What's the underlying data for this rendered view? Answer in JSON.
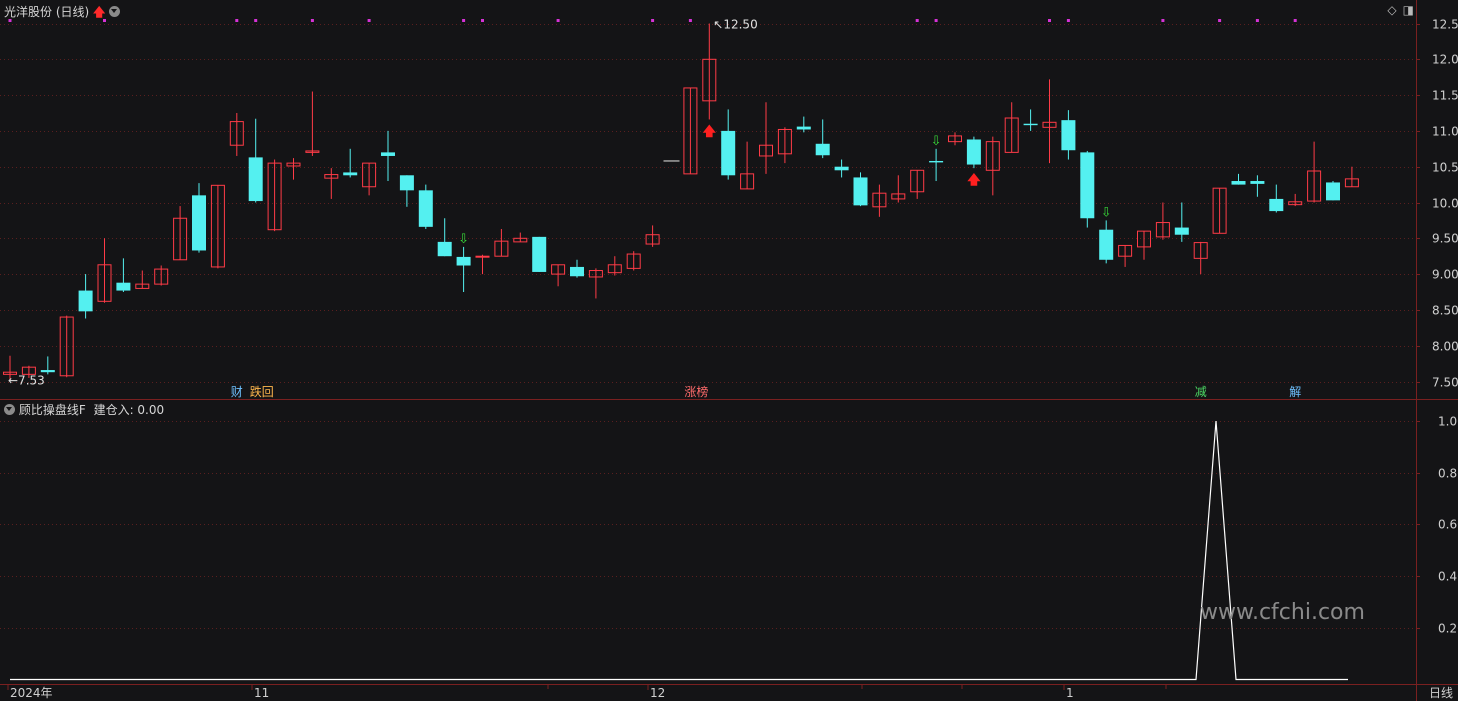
{
  "header": {
    "stock_title": "光洋股份 (日线)",
    "indicator_title": "顾比操盘线F",
    "indicator_value": "建仓入: 0.00"
  },
  "colors": {
    "bg": "#141416",
    "up": "#ff3b47",
    "down": "#54f0f0",
    "grid": "#5a1f1f",
    "signal_dot": "#d632d6"
  },
  "icons": [
    "up-arrow-icon",
    "chevron-down-icon",
    "diamond-icon",
    "panel-toggle-icon"
  ],
  "chart_data": [
    {
      "type": "candlestick",
      "yticks": [
        "12.50",
        "12.00",
        "11.50",
        "11.00",
        "10.50",
        "10.00",
        "9.50",
        "9.00",
        "8.50",
        "8.00",
        "7.50"
      ],
      "ylim": [
        7.4,
        12.65
      ],
      "high_label": "12.50",
      "low_label": "7.53",
      "x_labels": [
        "2024年",
        "11",
        "12",
        "1"
      ],
      "period_label": "日线",
      "candles": [
        [
          7.6,
          7.63,
          7.53,
          7.86
        ],
        [
          7.6,
          7.7,
          7.55,
          7.72
        ],
        [
          7.66,
          7.63,
          7.6,
          7.85
        ],
        [
          7.58,
          8.4,
          7.56,
          8.42
        ],
        [
          8.77,
          8.48,
          8.38,
          9.0
        ],
        [
          8.62,
          9.13,
          8.6,
          9.5
        ],
        [
          8.88,
          8.77,
          8.75,
          9.22
        ],
        [
          8.8,
          8.86,
          8.8,
          9.05
        ],
        [
          8.86,
          9.07,
          8.84,
          9.12
        ],
        [
          9.2,
          9.78,
          9.2,
          9.95
        ],
        [
          10.1,
          9.33,
          9.3,
          10.27
        ],
        [
          9.1,
          10.24,
          9.08,
          10.24
        ],
        [
          10.8,
          11.13,
          10.65,
          11.25
        ],
        [
          10.63,
          10.02,
          10.0,
          11.17
        ],
        [
          9.62,
          10.55,
          9.6,
          10.6
        ],
        [
          10.51,
          10.55,
          10.32,
          10.62
        ],
        [
          10.7,
          10.72,
          10.65,
          11.55
        ],
        [
          10.34,
          10.39,
          10.05,
          10.48
        ],
        [
          10.42,
          10.38,
          10.35,
          10.75
        ],
        [
          10.22,
          10.55,
          10.1,
          10.55
        ],
        [
          10.7,
          10.65,
          10.3,
          11.0
        ],
        [
          10.38,
          10.17,
          9.94,
          10.38
        ],
        [
          10.17,
          9.66,
          9.63,
          10.25
        ],
        [
          9.45,
          9.25,
          9.25,
          9.78
        ],
        [
          9.24,
          9.12,
          8.75,
          9.38
        ],
        [
          9.24,
          9.25,
          9.0,
          9.27
        ],
        [
          9.25,
          9.46,
          9.25,
          9.63
        ],
        [
          9.45,
          9.5,
          9.45,
          9.58
        ],
        [
          9.52,
          9.03,
          9.03,
          9.52
        ],
        [
          9.0,
          9.13,
          8.83,
          9.13
        ],
        [
          9.1,
          8.97,
          8.95,
          9.2
        ],
        [
          8.96,
          9.05,
          8.66,
          9.08
        ],
        [
          9.02,
          9.13,
          8.98,
          9.25
        ],
        [
          9.08,
          9.28,
          9.05,
          9.32
        ],
        [
          9.42,
          9.55,
          9.38,
          9.68
        ],
        [
          10.58,
          10.58,
          10.58,
          10.58
        ],
        [
          10.4,
          11.6,
          10.4,
          11.6
        ],
        [
          11.42,
          12.0,
          11.16,
          12.5
        ],
        [
          11.0,
          10.38,
          10.32,
          11.3
        ],
        [
          10.19,
          10.4,
          10.19,
          10.85
        ],
        [
          10.65,
          10.8,
          10.4,
          11.4
        ],
        [
          10.68,
          11.02,
          10.55,
          11.05
        ],
        [
          11.06,
          11.02,
          10.98,
          11.2
        ],
        [
          10.82,
          10.66,
          10.62,
          11.16
        ],
        [
          10.5,
          10.45,
          10.35,
          10.6
        ],
        [
          10.35,
          9.96,
          9.95,
          10.42
        ],
        [
          9.94,
          10.13,
          9.8,
          10.25
        ],
        [
          10.05,
          10.12,
          10.0,
          10.38
        ],
        [
          10.15,
          10.45,
          10.05,
          10.45
        ],
        [
          10.58,
          10.56,
          10.3,
          10.75
        ],
        [
          10.85,
          10.93,
          10.8,
          10.98
        ],
        [
          10.88,
          10.53,
          10.48,
          10.92
        ],
        [
          10.45,
          10.85,
          10.1,
          10.92
        ],
        [
          10.7,
          11.18,
          10.7,
          11.4
        ],
        [
          11.1,
          11.08,
          11.0,
          11.3
        ],
        [
          11.05,
          11.12,
          10.55,
          11.72
        ],
        [
          11.15,
          10.73,
          10.6,
          11.29
        ],
        [
          10.7,
          9.78,
          9.65,
          10.72
        ],
        [
          9.62,
          9.2,
          9.15,
          9.75
        ],
        [
          9.25,
          9.4,
          9.1,
          9.4
        ],
        [
          9.38,
          9.6,
          9.2,
          9.6
        ],
        [
          9.52,
          9.72,
          9.48,
          10.0
        ],
        [
          9.65,
          9.55,
          9.45,
          10.0
        ],
        [
          9.22,
          9.44,
          9.0,
          9.45
        ],
        [
          9.57,
          10.2,
          9.57,
          10.2
        ],
        [
          10.3,
          10.25,
          10.25,
          10.4
        ],
        [
          10.3,
          10.26,
          10.08,
          10.38
        ],
        [
          10.05,
          9.88,
          9.86,
          10.25
        ],
        [
          9.97,
          10.01,
          9.95,
          10.12
        ],
        [
          10.02,
          10.44,
          10.0,
          10.85
        ],
        [
          10.28,
          10.03,
          10.03,
          10.3
        ],
        [
          10.22,
          10.33,
          10.22,
          10.5
        ]
      ],
      "buy_arrows": [
        37,
        51
      ],
      "sell_arrows": [
        24,
        49,
        58
      ],
      "signal_dots": [
        0,
        5,
        12,
        13,
        16,
        19,
        24,
        25,
        29,
        34,
        36,
        48,
        49,
        55,
        56,
        61,
        64,
        66,
        68
      ],
      "event_labels": [
        {
          "index": 12,
          "text": "财",
          "color": "#6ec1ff"
        },
        {
          "index": 13,
          "text": "跌回",
          "color": "#ffb74d"
        },
        {
          "index": 36,
          "text": "涨榜",
          "color": "#ff6b6b"
        },
        {
          "index": 63,
          "text": "减",
          "color": "#4cd964"
        },
        {
          "index": 68,
          "text": "解",
          "color": "#6ec1ff"
        }
      ]
    },
    {
      "type": "line",
      "name": "建仓入",
      "yticks": [
        "1.00",
        "0.80",
        "0.60",
        "0.40",
        "0.20"
      ],
      "ylim": [
        0,
        1.0
      ],
      "values": [
        0,
        0,
        0,
        0,
        0,
        0,
        0,
        0,
        0,
        0,
        0,
        0,
        0,
        0,
        0,
        0,
        0,
        0,
        0,
        0,
        0,
        0,
        0,
        0,
        0,
        0,
        0,
        0,
        0,
        0,
        0,
        0,
        0,
        0,
        0,
        0,
        0,
        0,
        0,
        0,
        0,
        0,
        0,
        0,
        0,
        0,
        0,
        0,
        0,
        0,
        0,
        0,
        0,
        0,
        0,
        0,
        0,
        0,
        0,
        0,
        0,
        0,
        0,
        1,
        0,
        0,
        0,
        0,
        0,
        0,
        0
      ]
    }
  ],
  "watermark": "www.cfchi.com"
}
